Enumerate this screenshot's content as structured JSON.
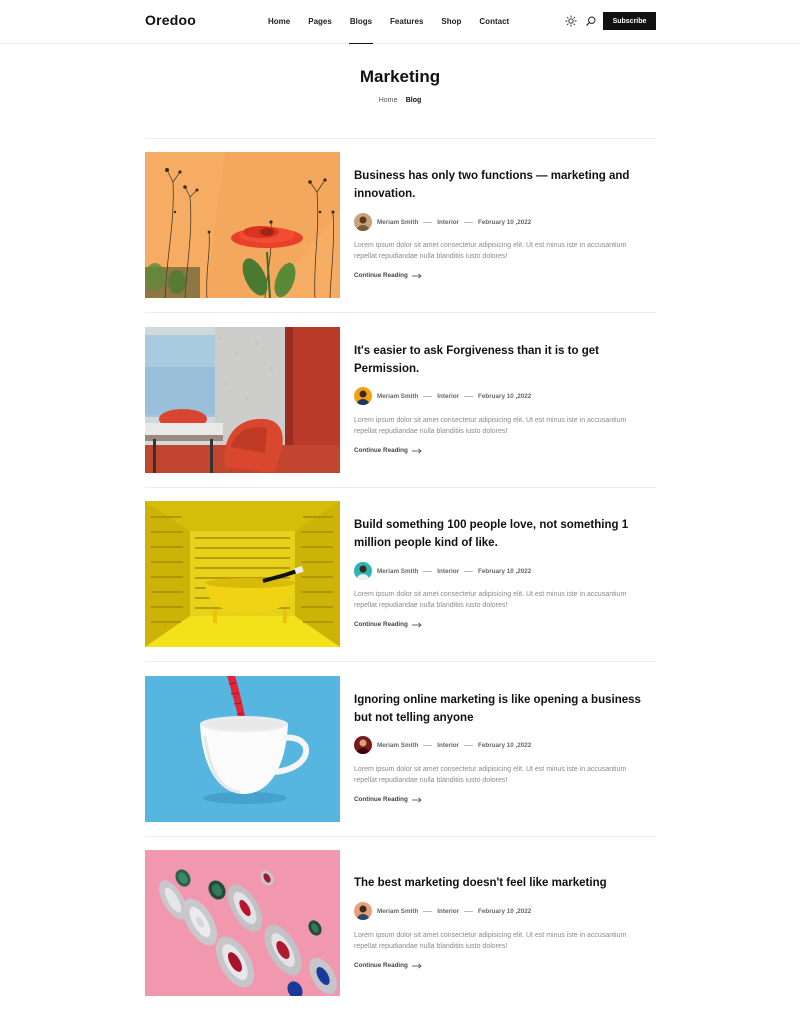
{
  "header": {
    "logo": "Oredoo",
    "nav": [
      "Home",
      "Pages",
      "Blogs",
      "Features",
      "Shop",
      "Contact"
    ],
    "active_nav": "Blogs",
    "icons": {
      "theme": "sun-icon",
      "search": "search-icon"
    },
    "subscribe_label": "Subscribe"
  },
  "page": {
    "title": "Marketing",
    "breadcrumb": {
      "home": "Home",
      "separator": "·",
      "current": "Blog"
    }
  },
  "posts": [
    {
      "title": "Business has only two functions — marketing and innovation.",
      "author": "Meriam Smith",
      "category": "Interior",
      "date": "February 10 ,2022",
      "excerpt": "Lorem ipsum dolor sit amet consectetur adipisicing elit. Ut est minus iste in accusantium repellat repudiandae nulla blanditiis iusto dolores!",
      "cta": "Continue Reading",
      "image": "orange wall with red flower"
    },
    {
      "title": "It's easier to ask Forgiveness than it is to get Permission.",
      "author": "Meriam Smith",
      "category": "Interior",
      "date": "February 10 ,2022",
      "excerpt": "Lorem ipsum dolor sit amet consectetur adipisicing elit. Ut est minus iste in accusantium repellat repudiandae nulla blanditiis iusto dolores!",
      "cta": "Continue Reading",
      "image": "meeting room with red chair"
    },
    {
      "title": "Build something 100 people love, not something 1 million people kind of like.",
      "author": "Meriam Smith",
      "category": "Interior",
      "date": "February 10 ,2022",
      "excerpt": "Lorem ipsum dolor sit amet consectetur adipisicing elit. Ut est minus iste in accusantium repellat repudiandae nulla blanditiis iusto dolores!",
      "cta": "Continue Reading",
      "image": "yellow room with bathtub"
    },
    {
      "title": "Ignoring online marketing is like opening a business but not telling anyone",
      "author": "Meriam Smith",
      "category": "Interior",
      "date": "February 10 ,2022",
      "excerpt": "Lorem ipsum dolor sit amet consectetur adipisicing elit. Ut est minus iste in accusantium repellat repudiandae nulla blanditiis iusto dolores!",
      "cta": "Continue Reading",
      "image": "white cup on blue background"
    },
    {
      "title": "The best marketing doesn't feel like marketing",
      "author": "Meriam Smith",
      "category": "Interior",
      "date": "February 10 ,2022",
      "excerpt": "Lorem ipsum dolor sit amet consectetur adipisicing elit. Ut est minus iste in accusantium repellat repudiandae nulla blanditiis iusto dolores!",
      "cta": "Continue Reading",
      "image": "jeweled earrings on pink background"
    }
  ]
}
